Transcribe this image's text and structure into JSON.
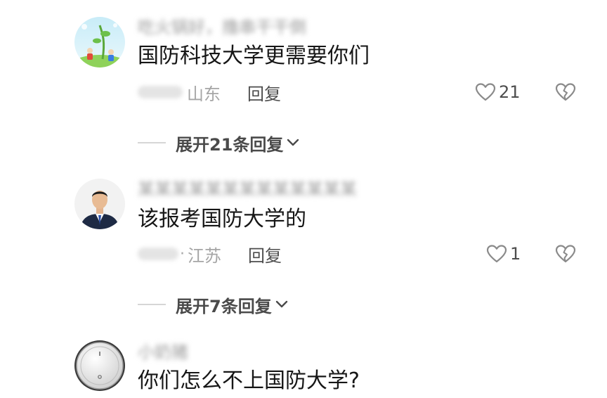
{
  "comments": [
    {
      "username": "吃火锅好，撸串干干倒",
      "text": "国防科技大学更需要你们",
      "location": "山东",
      "reply_label": "回复",
      "likes": "21",
      "expand_label": "展开21条回复"
    },
    {
      "username": "某某某某某某某某某某某某某",
      "text": "该报考国防大学的",
      "location": "江苏",
      "reply_label": "回复",
      "likes": "1",
      "expand_label": "展开7条回复"
    },
    {
      "username": "小奶猪",
      "text": "你们怎么不上国防大学?"
    }
  ],
  "colors": {
    "comment_text": "#161616",
    "meta_text": "#a6a6a6",
    "action_text": "#4d4d4d",
    "icon_stroke": "#8a8a8a"
  },
  "icons": {
    "like": "heart-icon",
    "dislike": "broken-heart-icon",
    "expand": "chevron-down-icon"
  }
}
